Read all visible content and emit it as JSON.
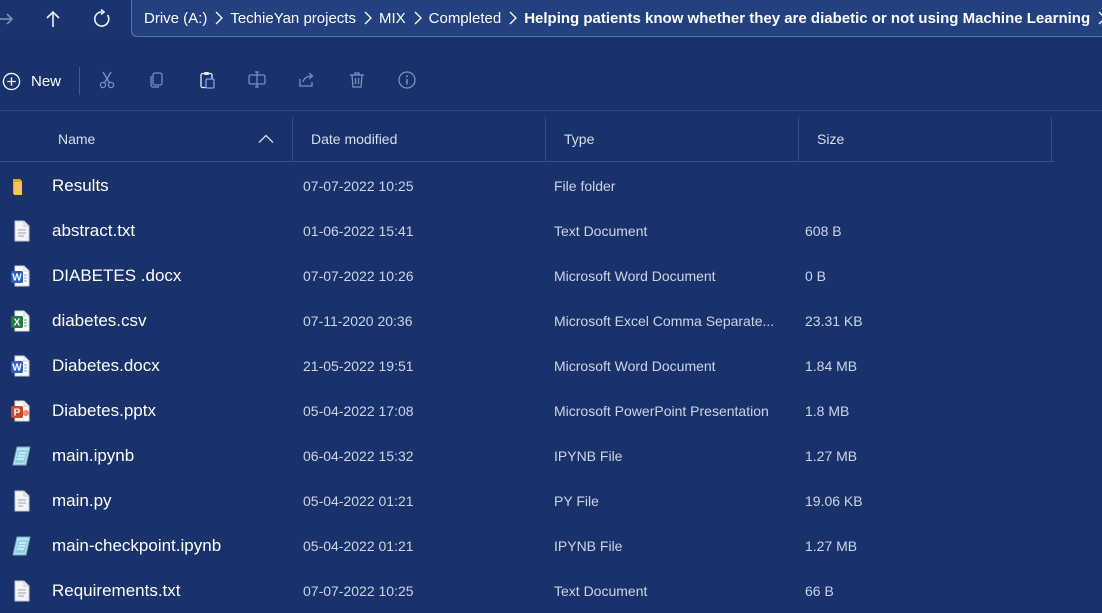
{
  "address_bar": {
    "breadcrumbs": [
      "Drive (A:)",
      "TechieYan projects",
      "MIX",
      "Completed",
      "Helping patients know whether they are diabetic or not using Machine Learning"
    ]
  },
  "command_bar": {
    "new_label": "New",
    "tools": [
      "cut-icon",
      "copy-icon",
      "paste-icon",
      "rename-icon",
      "share-icon",
      "delete-icon",
      "info-icon"
    ]
  },
  "columns": {
    "name": "Name",
    "date_modified": "Date modified",
    "type": "Type",
    "size": "Size"
  },
  "files": [
    {
      "name": "Results",
      "date": "07-07-2022 10:25",
      "type": "File folder",
      "size": "",
      "icon": "folder-icon"
    },
    {
      "name": "abstract.txt",
      "date": "01-06-2022 15:41",
      "type": "Text Document",
      "size": "608 B",
      "icon": "text-file-icon"
    },
    {
      "name": "DIABETES .docx",
      "date": "07-07-2022 10:26",
      "type": "Microsoft Word Document",
      "size": "0 B",
      "icon": "word-file-icon"
    },
    {
      "name": "diabetes.csv",
      "date": "07-11-2020 20:36",
      "type": "Microsoft Excel Comma Separate...",
      "size": "23.31 KB",
      "icon": "excel-file-icon"
    },
    {
      "name": "Diabetes.docx",
      "date": "21-05-2022 19:51",
      "type": "Microsoft Word Document",
      "size": "1.84 MB",
      "icon": "word-file-icon"
    },
    {
      "name": "Diabetes.pptx",
      "date": "05-04-2022 17:08",
      "type": "Microsoft PowerPoint Presentation",
      "size": "1.8 MB",
      "icon": "powerpoint-file-icon"
    },
    {
      "name": "main.ipynb",
      "date": "06-04-2022 15:32",
      "type": "IPYNB File",
      "size": "1.27 MB",
      "icon": "ipynb-file-icon"
    },
    {
      "name": "main.py",
      "date": "05-04-2022 01:21",
      "type": "PY File",
      "size": "19.06 KB",
      "icon": "py-file-icon"
    },
    {
      "name": "main-checkpoint.ipynb",
      "date": "05-04-2022 01:21",
      "type": "IPYNB File",
      "size": "1.27 MB",
      "icon": "ipynb-file-icon"
    },
    {
      "name": "Requirements.txt",
      "date": "07-07-2022 10:25",
      "type": "Text Document",
      "size": "66 B",
      "icon": "text-file-icon"
    }
  ],
  "colors": {
    "background": "#19326b",
    "address_bar": "#234080",
    "word": "#2b5fbf",
    "excel": "#1f7a46",
    "powerpoint": "#d24a26",
    "folder": "#f3c94d"
  }
}
